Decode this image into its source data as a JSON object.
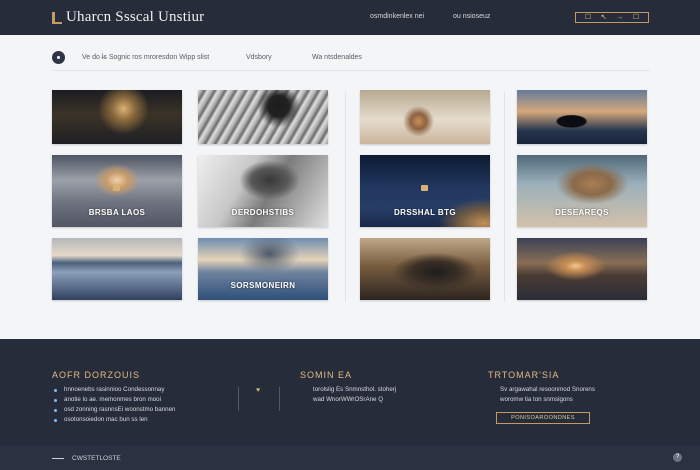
{
  "header": {
    "brand": "Uharcn Ssscal Unstiur",
    "nav": [
      "osmdinkenlex nei",
      "ou nsioseuz"
    ],
    "controls": [
      "☐",
      "↖",
      "→",
      "☐"
    ]
  },
  "subnav": {
    "items": [
      "Ve do l̶s Sognic ros mroresdon Wipp slist",
      "Vdsbory",
      "Wa ntsdenaldes"
    ]
  },
  "gallery": {
    "captions": [
      "BRSBA LAOS",
      "DERDOHSTIBS",
      "DRSSHAL BTG",
      "DESEAREQS",
      "SORSMONEIRN"
    ]
  },
  "footer": {
    "col1": {
      "title": "AOFR DORZOUIS",
      "items": [
        "hnnoenebs rasinnioo Condessonnay",
        "anotie lo ae. memonmes bron mooi",
        "osd zonning rasnnsEi woonstmo bannen",
        "osotonsoiedon mac bun ss len"
      ]
    },
    "col2": {
      "title": "SOMIN EA",
      "lines": [
        "torolslig Es Snmnsthol. stoherj",
        "wad WnorWWrOSrAne Q"
      ]
    },
    "col3": {
      "title": "TRTOMAR'SIA",
      "lines": [
        "Sv argawahal resoonmod Snorens",
        "woromw tia ton snmslgons"
      ],
      "button": "PONISOAROONDNES"
    }
  },
  "bottom": {
    "label": "CWSTETLOSTE",
    "help": "?"
  }
}
